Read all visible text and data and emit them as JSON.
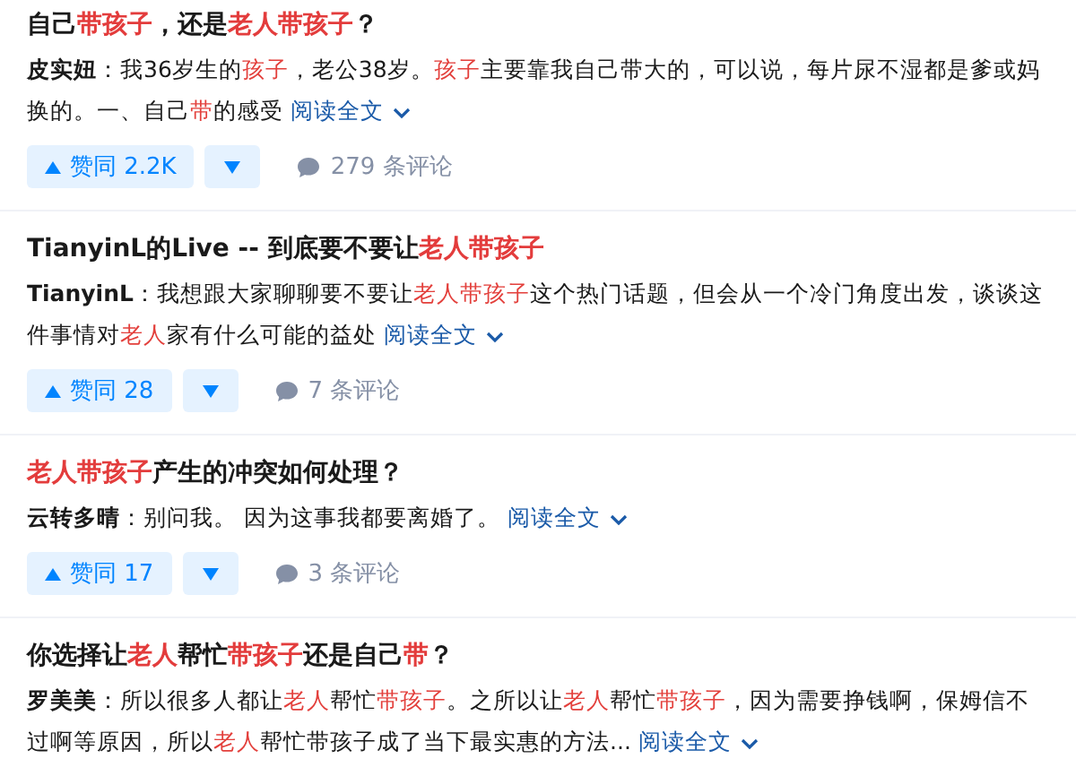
{
  "answers": [
    {
      "title": [
        {
          "text": "自己",
          "highlight": false
        },
        {
          "text": "带孩子",
          "highlight": true
        },
        {
          "text": "，还是",
          "highlight": false
        },
        {
          "text": "老人带孩子",
          "highlight": true
        },
        {
          "text": "？",
          "highlight": false
        }
      ],
      "author": "皮实妞",
      "excerpt": [
        {
          "text": "：我36岁生的",
          "highlight": false
        },
        {
          "text": "孩子",
          "highlight": true
        },
        {
          "text": "，老公38岁。",
          "highlight": false
        },
        {
          "text": "孩子",
          "highlight": true
        },
        {
          "text": "主要靠我自己带大的，可以说，每片尿不湿都是爹或妈换的。一、自己",
          "highlight": false
        },
        {
          "text": "带",
          "highlight": true
        },
        {
          "text": "的感受",
          "highlight": false
        }
      ],
      "read_more": "阅读全文",
      "upvote": "赞同 2.2K",
      "comments": "279 条评论"
    },
    {
      "title": [
        {
          "text": "TianyinL的Live -- 到底要不要让",
          "highlight": false
        },
        {
          "text": "老人带孩子",
          "highlight": true
        }
      ],
      "author": "TianyinL",
      "excerpt": [
        {
          "text": "：我想跟大家聊聊要不要让",
          "highlight": false
        },
        {
          "text": "老人带孩子",
          "highlight": true
        },
        {
          "text": "这个热门话题，但会从一个冷门角度出发，谈谈这件事情对",
          "highlight": false
        },
        {
          "text": "老人",
          "highlight": true
        },
        {
          "text": "家有什么可能的益处",
          "highlight": false
        }
      ],
      "read_more": "阅读全文",
      "upvote": "赞同 28",
      "comments": "7 条评论"
    },
    {
      "title": [
        {
          "text": "老人带孩子",
          "highlight": true
        },
        {
          "text": "产生的冲突如何处理？",
          "highlight": false
        }
      ],
      "author": "云转多晴",
      "excerpt": [
        {
          "text": "：别问我。 因为这事我都要离婚了。",
          "highlight": false
        }
      ],
      "read_more": "阅读全文",
      "upvote": "赞同 17",
      "comments": "3 条评论"
    },
    {
      "title": [
        {
          "text": "你选择让",
          "highlight": false
        },
        {
          "text": "老人",
          "highlight": true
        },
        {
          "text": "帮忙",
          "highlight": false
        },
        {
          "text": "带孩子",
          "highlight": true
        },
        {
          "text": "还是自己",
          "highlight": false
        },
        {
          "text": "带",
          "highlight": true
        },
        {
          "text": "？",
          "highlight": false
        }
      ],
      "author": "罗美美",
      "excerpt": [
        {
          "text": "：所以很多人都让",
          "highlight": false
        },
        {
          "text": "老人",
          "highlight": true
        },
        {
          "text": "帮忙",
          "highlight": false
        },
        {
          "text": "带孩子",
          "highlight": true
        },
        {
          "text": "。之所以让",
          "highlight": false
        },
        {
          "text": "老人",
          "highlight": true
        },
        {
          "text": "帮忙",
          "highlight": false
        },
        {
          "text": "带孩子",
          "highlight": true
        },
        {
          "text": "，因为需要挣钱啊，保姆信不过啊等原因，所以",
          "highlight": false
        },
        {
          "text": "老人",
          "highlight": true
        },
        {
          "text": "帮忙带孩子成了当下最实惠的方法...",
          "highlight": false
        }
      ],
      "read_more": "阅读全文"
    }
  ]
}
